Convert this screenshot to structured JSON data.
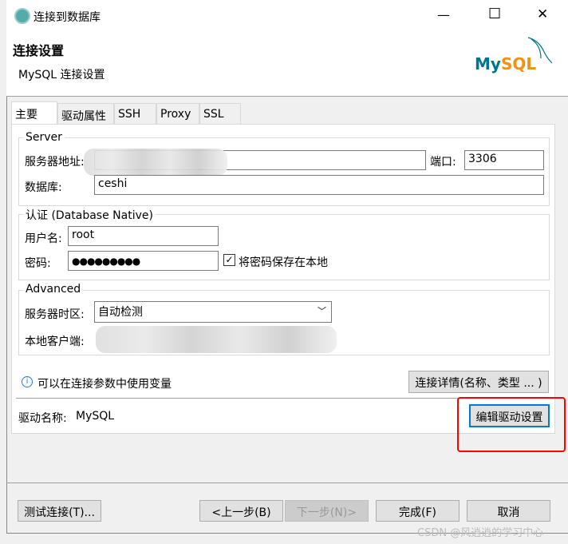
{
  "window": {
    "title": "连接到数据库",
    "minimize": "—",
    "maximize": "☐",
    "close": "✕"
  },
  "header": {
    "title": "连接设置",
    "subtitle": "MySQL 连接设置",
    "logo_text": "MySQL"
  },
  "tabs": [
    "主要",
    "驱动属性",
    "SSH",
    "Proxy",
    "SSL"
  ],
  "server": {
    "legend": "Server",
    "host_label": "服务器地址:",
    "port_label": "端口:",
    "port": "3306",
    "db_label": "数据库:",
    "db": "ceshi"
  },
  "auth": {
    "legend": "认证 (Database Native)",
    "user_label": "用户名:",
    "user": "root",
    "pass_label": "密码:",
    "pass": "●●●●●●●●●",
    "save_label": "将密码保存在本地",
    "save_checked": true
  },
  "advanced": {
    "legend": "Advanced",
    "tz_label": "服务器时区:",
    "tz": "自动检测",
    "client_label": "本地客户端:"
  },
  "info": {
    "text": "可以在连接参数中使用变量",
    "details_button": "连接详情(名称、类型 ... )"
  },
  "driver": {
    "label": "驱动名称:",
    "name": "MySQL",
    "edit_button": "编辑驱动设置"
  },
  "footer": {
    "test": "测试连接(T)...",
    "prev": "<上一步(B)",
    "next": "下一步(N)>",
    "finish": "完成(F)",
    "cancel": "取消"
  },
  "watermark": "CSDN @风逍逍的学习中心",
  "colors": {
    "highlight": "#ff0000",
    "mysql_teal": "#00758f",
    "mysql_orange": "#f29111"
  }
}
